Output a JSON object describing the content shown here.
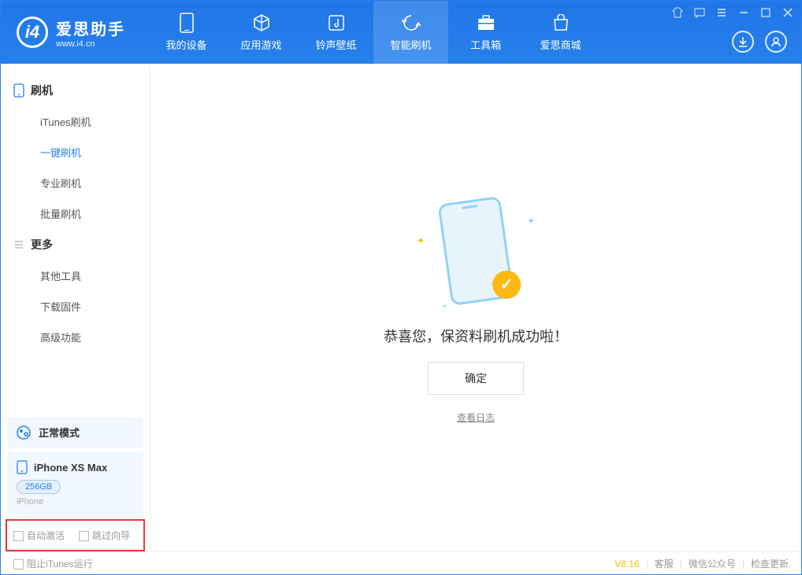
{
  "brand": {
    "name": "爱思助手",
    "url": "www.i4.cn"
  },
  "nav": [
    {
      "label": "我的设备"
    },
    {
      "label": "应用游戏"
    },
    {
      "label": "铃声壁纸"
    },
    {
      "label": "智能刷机"
    },
    {
      "label": "工具箱"
    },
    {
      "label": "爱思商城"
    }
  ],
  "sidebar": {
    "section1": "刷机",
    "items1": [
      "iTunes刷机",
      "一键刷机",
      "专业刷机",
      "批量刷机"
    ],
    "section2": "更多",
    "items2": [
      "其他工具",
      "下载固件",
      "高级功能"
    ]
  },
  "mode": {
    "label": "正常模式"
  },
  "device": {
    "name": "iPhone XS Max",
    "badge": "256GB",
    "type": "iPhone"
  },
  "options": {
    "opt1": "自动激活",
    "opt2": "跳过向导"
  },
  "main": {
    "message": "恭喜您，保资料刷机成功啦！",
    "ok": "确定",
    "log": "查看日志"
  },
  "footer": {
    "stop_itunes": "阻止iTunes运行",
    "version": "V8.16",
    "links": [
      "客服",
      "微信公众号",
      "检查更新"
    ]
  }
}
